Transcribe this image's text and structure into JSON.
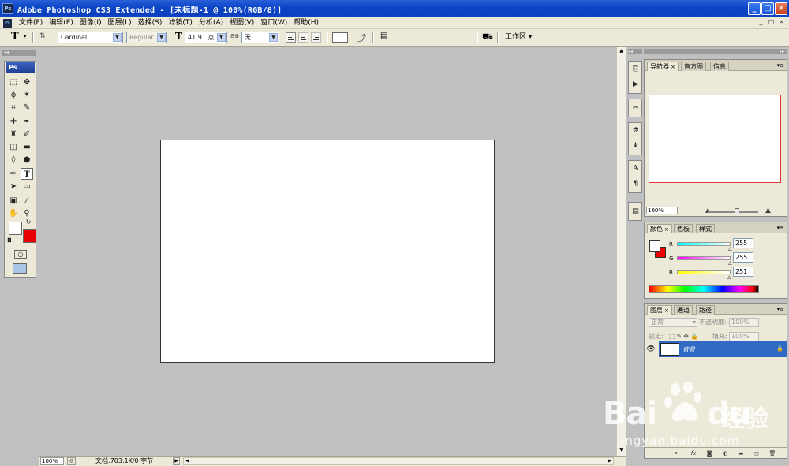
{
  "window": {
    "title": "Adobe Photoshop CS3 Extended - [未标题-1 @ 100%(RGB/8)]",
    "app_icon": "Ps",
    "minimize": "_",
    "maximize": "□",
    "close": "×"
  },
  "menu": {
    "items": [
      "文件(F)",
      "编辑(E)",
      "图像(I)",
      "图层(L)",
      "选择(S)",
      "滤镜(T)",
      "分析(A)",
      "视图(V)",
      "窗口(W)",
      "帮助(H)"
    ],
    "doc_controls": [
      "_",
      "□",
      "×"
    ]
  },
  "options": {
    "tool_icon": "T",
    "font_family": "Cardinal",
    "font_style": "Regular",
    "font_size": "41.91 点",
    "antialias_icon": "aa",
    "antialias": "无",
    "workspace": "工作区 ▾"
  },
  "toolbox": {
    "header": "Ps",
    "collapse": "◂◂"
  },
  "status": {
    "zoom": "100%",
    "doc_info": "文档:703.1K/0 字节"
  },
  "dock": {
    "collapse": "◂◂"
  },
  "panels": {
    "collapse": "▸▸",
    "navigator": {
      "tabs": [
        "导航器",
        "直方图",
        "信息"
      ],
      "zoom": "100%"
    },
    "color": {
      "tabs": [
        "颜色",
        "色板",
        "样式"
      ],
      "channels": [
        {
          "label": "R",
          "value": "255"
        },
        {
          "label": "G",
          "value": "255"
        },
        {
          "label": "B",
          "value": "251"
        }
      ],
      "background": "#e80000"
    },
    "layers": {
      "tabs": [
        "图层",
        "通道",
        "路径"
      ],
      "blend_mode": "正常",
      "opacity_label": "不透明度:",
      "opacity": "100%",
      "lock_label": "锁定:",
      "fill_label": "填充:",
      "fill": "100%",
      "layer_name": "背景"
    }
  },
  "watermark": {
    "text": "Bai",
    "text2": "du",
    "cn": "经验",
    "url": "jingyan.baidu.com"
  },
  "colors": {
    "selection": "#316ac5",
    "title_bar": "#0b47c8",
    "navigator_frame": "#dd3333"
  }
}
